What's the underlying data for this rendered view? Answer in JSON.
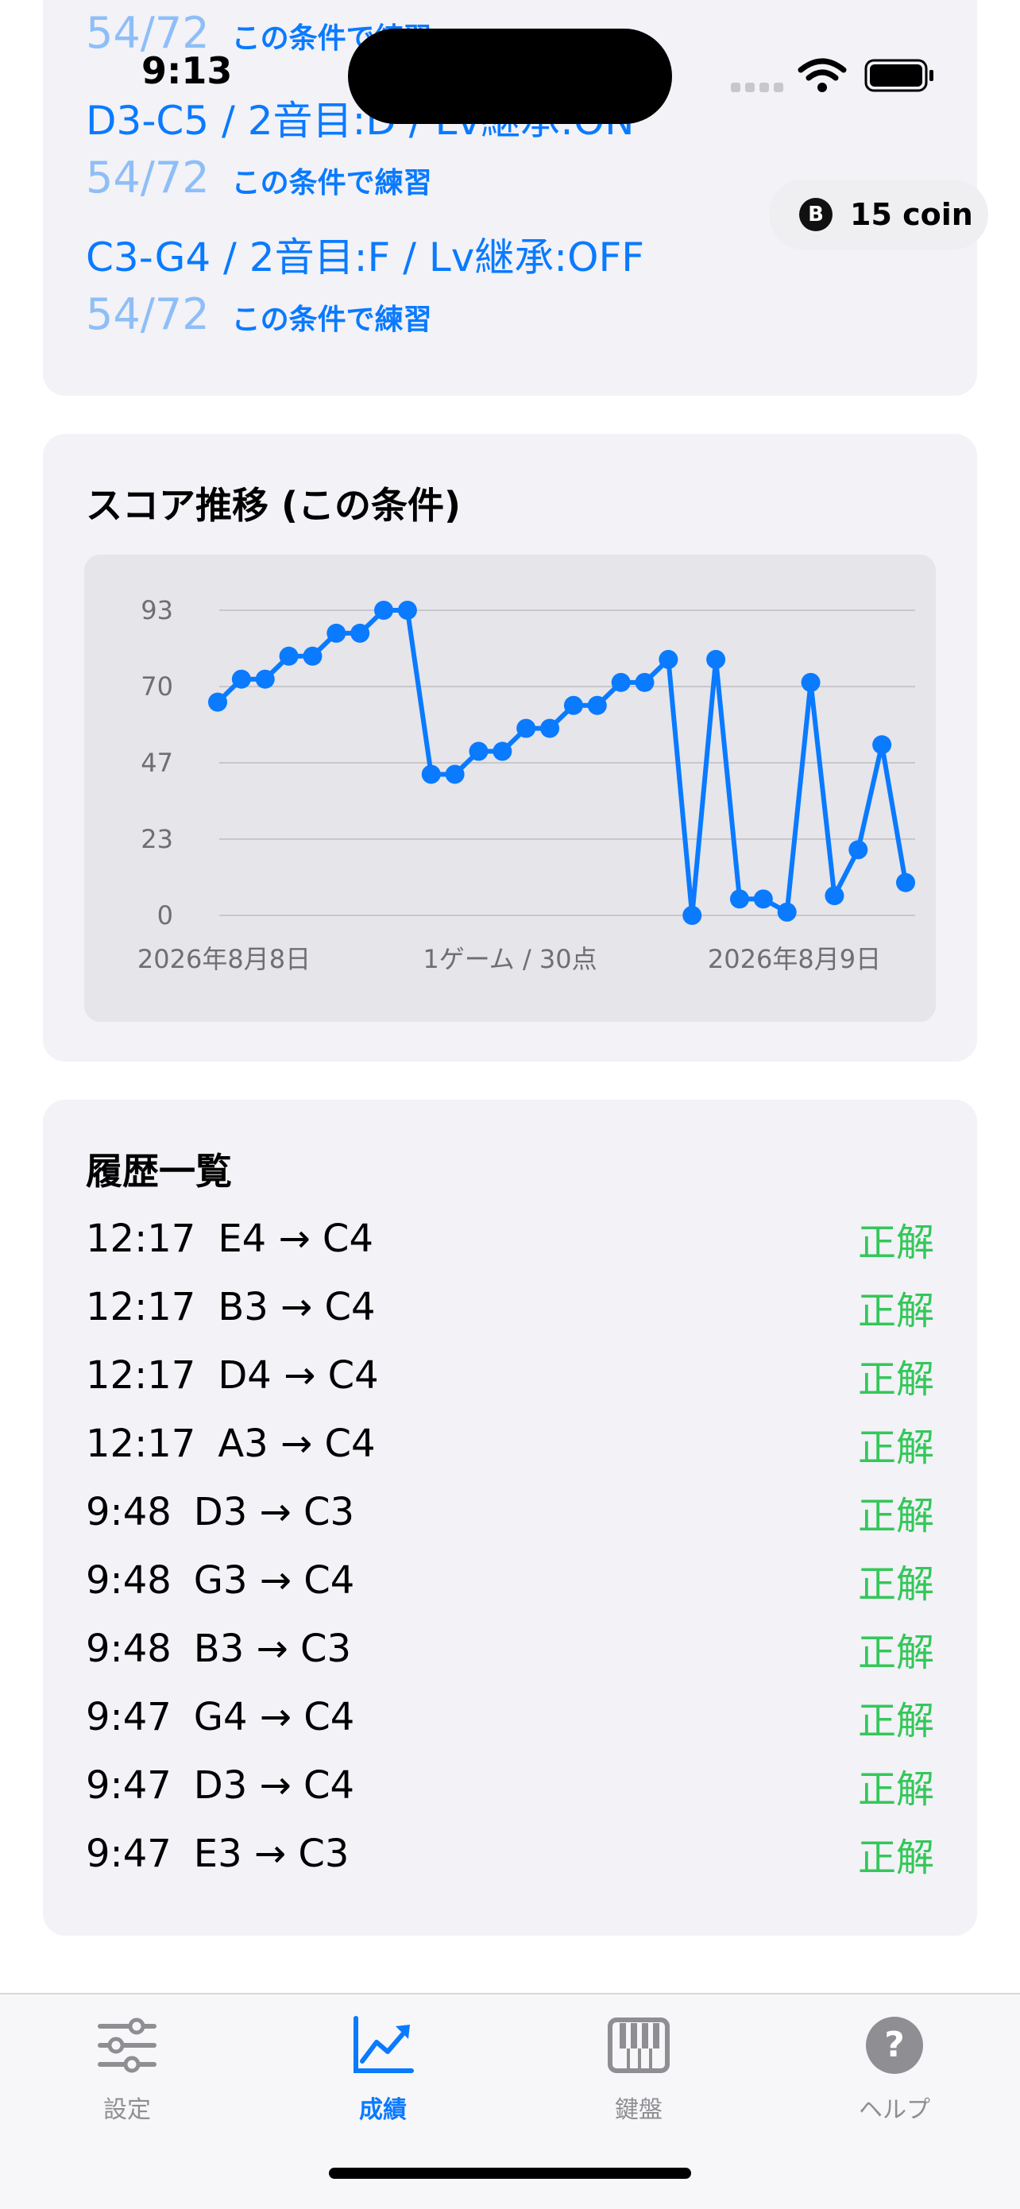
{
  "status_bar": {
    "time": "9:13"
  },
  "coin_badge": {
    "icon_letter": "B",
    "label": "15 coin"
  },
  "conditions": [
    {
      "score": "54/72",
      "practice": "この条件で練習"
    },
    {
      "label": "D3-C5 / 2音目:D / Lv継承:ON",
      "score": "54/72",
      "practice": "この条件で練習"
    },
    {
      "label": "C3-G4 / 2音目:F / Lv継承:OFF",
      "score": "54/72",
      "practice": "この条件で練習"
    }
  ],
  "score_section": {
    "title": "スコア推移 (この条件)"
  },
  "chart_data": {
    "type": "line",
    "title": "",
    "y_ticks": [
      "93",
      "70",
      "47",
      "23",
      "0"
    ],
    "ylim": [
      0,
      93
    ],
    "x_tick_labels": [
      "2026年8月8日",
      "1ゲーム / 30点",
      "2026年8月9日"
    ],
    "grid": true,
    "color": "#0a7aff",
    "series": [
      {
        "values": [
          65,
          72,
          72,
          79,
          79,
          86,
          86,
          93,
          93,
          43,
          43,
          50,
          50,
          57,
          57,
          64,
          64,
          71,
          71,
          78,
          0,
          78,
          5,
          5,
          1,
          71,
          6,
          20,
          52,
          10
        ]
      }
    ]
  },
  "history": {
    "title": "履歴一覧",
    "rows": [
      {
        "time": "12:17",
        "move": "E4 → C4",
        "result": "正解"
      },
      {
        "time": "12:17",
        "move": "B3 → C4",
        "result": "正解"
      },
      {
        "time": "12:17",
        "move": "D4 → C4",
        "result": "正解"
      },
      {
        "time": "12:17",
        "move": "A3 → C4",
        "result": "正解"
      },
      {
        "time": "9:48",
        "move": "D3 → C3",
        "result": "正解"
      },
      {
        "time": "9:48",
        "move": "G3 → C4",
        "result": "正解"
      },
      {
        "time": "9:48",
        "move": "B3 → C3",
        "result": "正解"
      },
      {
        "time": "9:47",
        "move": "G4 → C4",
        "result": "正解"
      },
      {
        "time": "9:47",
        "move": "D3 → C4",
        "result": "正解"
      },
      {
        "time": "9:47",
        "move": "E3 → C3",
        "result": "正解"
      }
    ]
  },
  "tabs": [
    {
      "label": "設定",
      "icon": "sliders-icon",
      "active": false
    },
    {
      "label": "成績",
      "icon": "chart-up-icon",
      "active": true
    },
    {
      "label": "鍵盤",
      "icon": "piano-icon",
      "active": false
    },
    {
      "label": "ヘルプ",
      "icon": "help-icon",
      "active": false
    }
  ],
  "colors": {
    "accent": "#0a7aff",
    "correct": "#34c759",
    "card_bg": "#f2f2f7"
  }
}
